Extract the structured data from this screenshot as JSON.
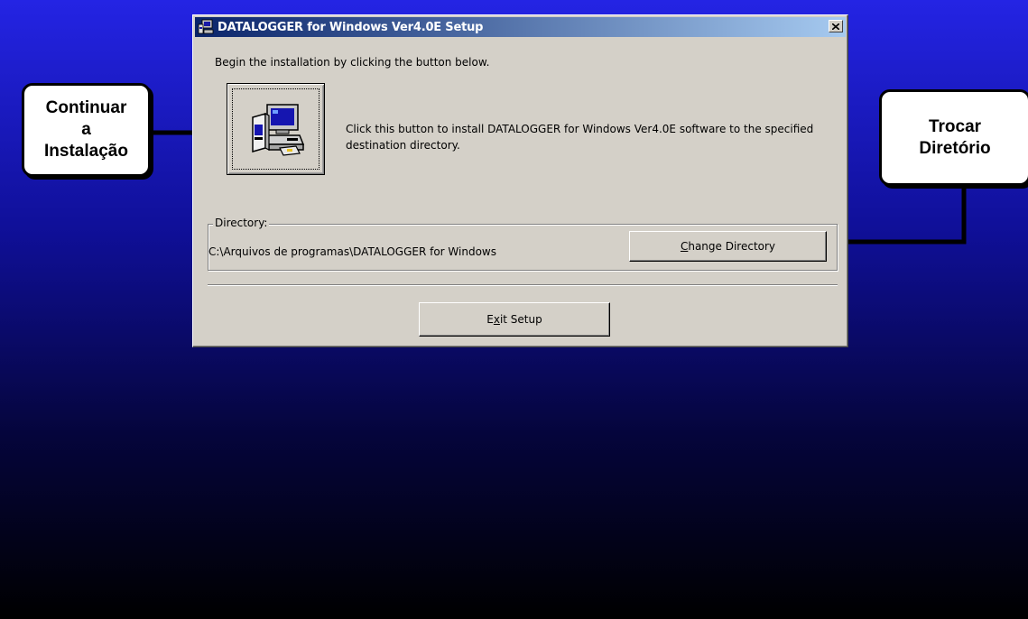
{
  "callouts": {
    "left": {
      "lines": [
        "Continuar",
        "a",
        "Instalação"
      ]
    },
    "right": {
      "lines": [
        "Trocar",
        "Diretório"
      ]
    }
  },
  "dialog": {
    "title": "DATALOGGER for Windows Ver4.0E Setup",
    "close_label": "×",
    "intro": "Begin the installation by clicking the button below.",
    "install_description": "Click this button to install DATALOGGER for Windows Ver4.0E software to the specified destination directory.",
    "directory_group_label": "Directory:",
    "directory_path": "C:\\Arquivos de programas\\DATALOGGER for Windows",
    "change_button": {
      "mnemonic": "C",
      "rest": "hange Directory"
    },
    "exit_button": {
      "pre": "E",
      "mnemonic": "x",
      "rest": "it Setup"
    }
  },
  "colors": {
    "background_top": "#2424e4",
    "background_bottom": "#000000",
    "dialog_face": "#d4d0c8",
    "titlebar_start": "#0a246a",
    "titlebar_end": "#a6caf0"
  },
  "icons": [
    "setup-computer-icon",
    "install-computer-icon",
    "close-icon",
    "arrow-right-icon",
    "arrow-left-icon"
  ]
}
